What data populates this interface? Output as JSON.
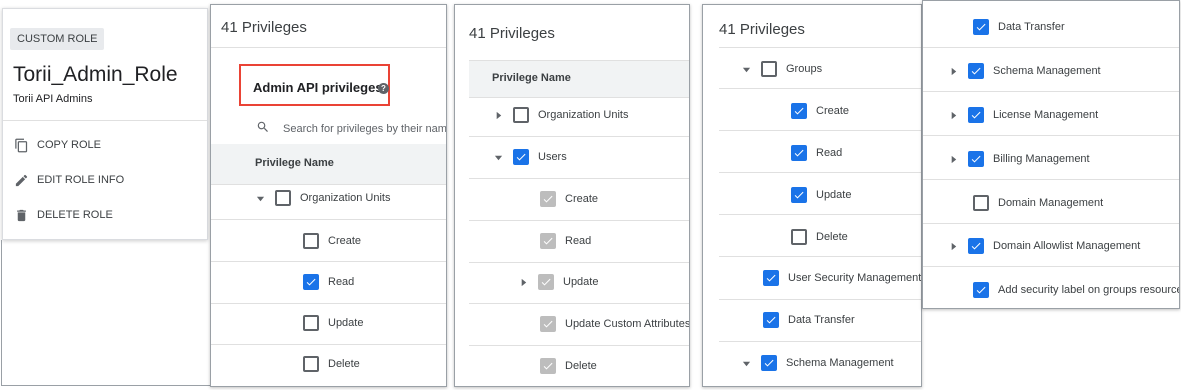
{
  "role_card": {
    "chip": "CUSTOM ROLE",
    "name": "Torii_Admin_Role",
    "description": "Torii API Admins",
    "actions": [
      {
        "icon": "copy-icon",
        "label": "COPY ROLE"
      },
      {
        "icon": "pencil-icon",
        "label": "EDIT ROLE INFO"
      },
      {
        "icon": "trash-icon",
        "label": "DELETE ROLE"
      }
    ]
  },
  "panel2": {
    "title": "41 Privileges",
    "section_title": "Admin API privileges",
    "search_placeholder": "Search for privileges by their nam",
    "column_header": "Privilege Name",
    "rows": [
      {
        "label": "Organization Units",
        "state": "unchecked",
        "caret": "down"
      },
      {
        "label": "Create",
        "state": "unchecked"
      },
      {
        "label": "Read",
        "state": "checked"
      },
      {
        "label": "Update",
        "state": "unchecked"
      },
      {
        "label": "Delete",
        "state": "unchecked"
      }
    ]
  },
  "panel3": {
    "title": "41 Privileges",
    "column_header": "Privilege Name",
    "rows": [
      {
        "label": "Organization Units",
        "state": "unchecked",
        "caret": "right"
      },
      {
        "label": "Users",
        "state": "checked",
        "caret": "down"
      },
      {
        "label": "Create",
        "state": "disabled-checked"
      },
      {
        "label": "Read",
        "state": "disabled-checked"
      },
      {
        "label": "Update",
        "state": "disabled-checked",
        "caret": "right"
      },
      {
        "label": "Update Custom Attributes",
        "state": "disabled-checked"
      },
      {
        "label": "Delete",
        "state": "disabled-checked"
      }
    ]
  },
  "panel4": {
    "title": "41 Privileges",
    "rows": [
      {
        "label": "Groups",
        "state": "unchecked",
        "caret": "down"
      },
      {
        "label": "Create",
        "state": "checked"
      },
      {
        "label": "Read",
        "state": "checked"
      },
      {
        "label": "Update",
        "state": "checked"
      },
      {
        "label": "Delete",
        "state": "unchecked"
      },
      {
        "label": "User Security Management",
        "state": "checked"
      },
      {
        "label": "Data Transfer",
        "state": "checked"
      },
      {
        "label": "Schema Management",
        "state": "checked",
        "caret": "down"
      }
    ]
  },
  "panel5": {
    "rows": [
      {
        "label": "Data Transfer",
        "state": "checked"
      },
      {
        "label": "Schema Management",
        "state": "checked",
        "caret": "right"
      },
      {
        "label": "License Management",
        "state": "checked",
        "caret": "right"
      },
      {
        "label": "Billing Management",
        "state": "checked",
        "caret": "right"
      },
      {
        "label": "Domain Management",
        "state": "unchecked"
      },
      {
        "label": "Domain Allowlist Management",
        "state": "checked",
        "caret": "right"
      },
      {
        "label": "Add security label on groups resource",
        "state": "checked"
      }
    ]
  },
  "colors": {
    "accent": "#1a73e8",
    "highlight": "#ea4335",
    "disabled": "#bdbdbd"
  }
}
